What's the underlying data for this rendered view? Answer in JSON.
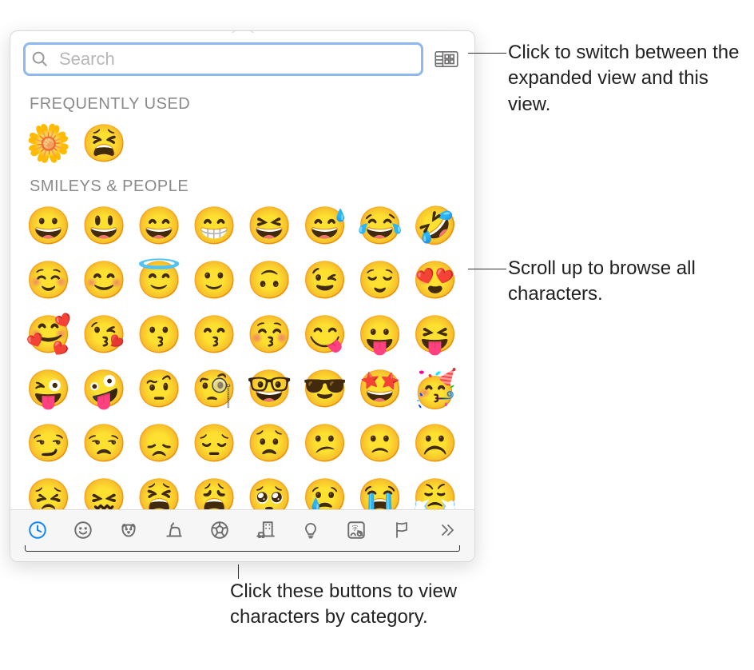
{
  "search": {
    "placeholder": "Search",
    "value": ""
  },
  "sections": {
    "frequently_used": {
      "title": "FREQUENTLY USED",
      "items": [
        "🌼",
        "😫"
      ]
    },
    "smileys_people": {
      "title": "SMILEYS & PEOPLE",
      "items": [
        "😀",
        "😃",
        "😄",
        "😁",
        "😆",
        "😅",
        "😂",
        "🤣",
        "☺️",
        "😊",
        "😇",
        "🙂",
        "🙃",
        "😉",
        "😌",
        "😍",
        "🥰",
        "😘",
        "😗",
        "😙",
        "😚",
        "😋",
        "😛",
        "😝",
        "😜",
        "🤪",
        "🤨",
        "🧐",
        "🤓",
        "😎",
        "🤩",
        "🥳",
        "😏",
        "😒",
        "😞",
        "😔",
        "😟",
        "😕",
        "🙁",
        "☹️",
        "😣",
        "😖",
        "😫",
        "😩",
        "🥺",
        "😢",
        "😭",
        "😤"
      ]
    }
  },
  "categories": [
    {
      "name": "frequently-used",
      "icon": "clock",
      "active": true
    },
    {
      "name": "smileys-people",
      "icon": "smiley",
      "active": false
    },
    {
      "name": "animals-nature",
      "icon": "animal",
      "active": false
    },
    {
      "name": "food-drink",
      "icon": "food",
      "active": false
    },
    {
      "name": "activity",
      "icon": "ball",
      "active": false
    },
    {
      "name": "travel-places",
      "icon": "travel",
      "active": false
    },
    {
      "name": "objects",
      "icon": "bulb",
      "active": false
    },
    {
      "name": "symbols",
      "icon": "symbols",
      "active": false
    },
    {
      "name": "flags",
      "icon": "flag",
      "active": false
    },
    {
      "name": "more",
      "icon": "chevrons",
      "active": false
    }
  ],
  "callouts": {
    "expand": "Click to switch between the expanded view and this view.",
    "scroll": "Scroll up to browse all characters.",
    "categories": "Click these buttons to view characters by category."
  }
}
